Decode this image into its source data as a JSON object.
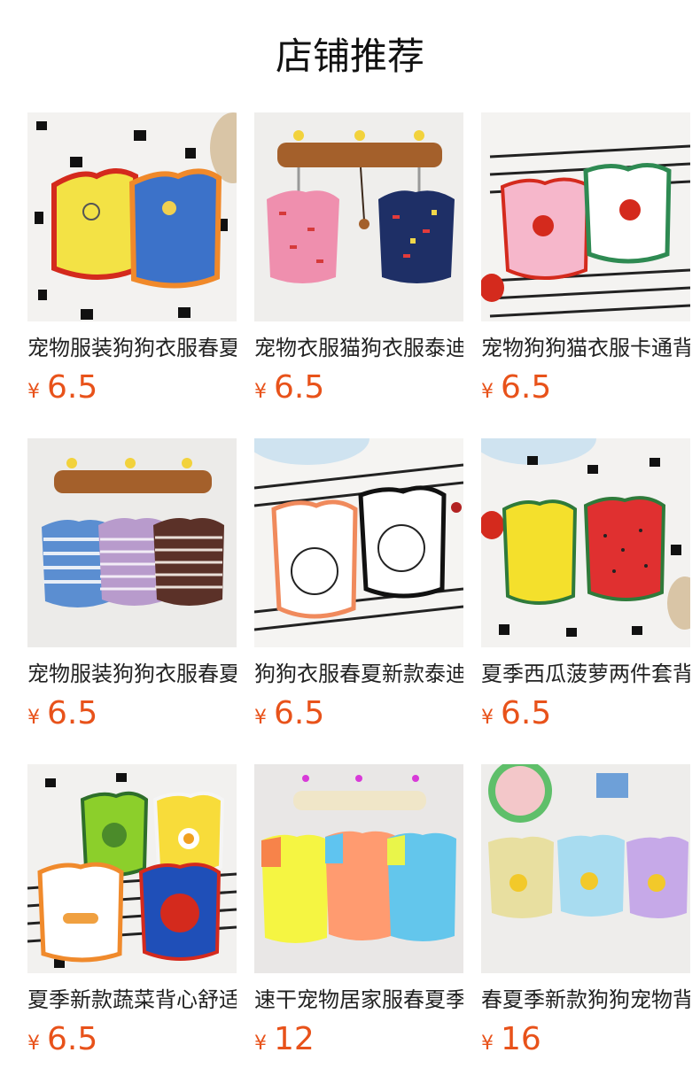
{
  "page": {
    "title": "店铺推荐"
  },
  "products": [
    {
      "name": "宠物服装狗狗衣服春夏",
      "currency": "¥",
      "price": "6.5",
      "image": "yellow-blue-paw-vests"
    },
    {
      "name": "宠物衣服猫狗衣服泰迪",
      "currency": "¥",
      "price": "6.5",
      "image": "pink-navy-print-vests-on-hanger"
    },
    {
      "name": "宠物狗狗猫衣服卡通背",
      "currency": "¥",
      "price": "6.5",
      "image": "cherry-vests"
    },
    {
      "name": "宠物服装狗狗衣服春夏",
      "currency": "¥",
      "price": "6.5",
      "image": "striped-vests-on-hanger"
    },
    {
      "name": "狗狗衣服春夏新款泰迪",
      "currency": "¥",
      "price": "6.5",
      "image": "bear-face-vests"
    },
    {
      "name": "夏季西瓜菠萝两件套背",
      "currency": "¥",
      "price": "6.5",
      "image": "pineapple-watermelon-vests"
    },
    {
      "name": "夏季新款蔬菜背心舒适",
      "currency": "¥",
      "price": "6.5",
      "image": "vegetable-print-vests"
    },
    {
      "name": "速干宠物居家服春夏季",
      "currency": "¥",
      "price": "12",
      "image": "neon-raglan-pajamas"
    },
    {
      "name": "春夏季新款狗狗宠物背",
      "currency": "¥",
      "price": "16",
      "image": "duck-overall-vests"
    }
  ]
}
